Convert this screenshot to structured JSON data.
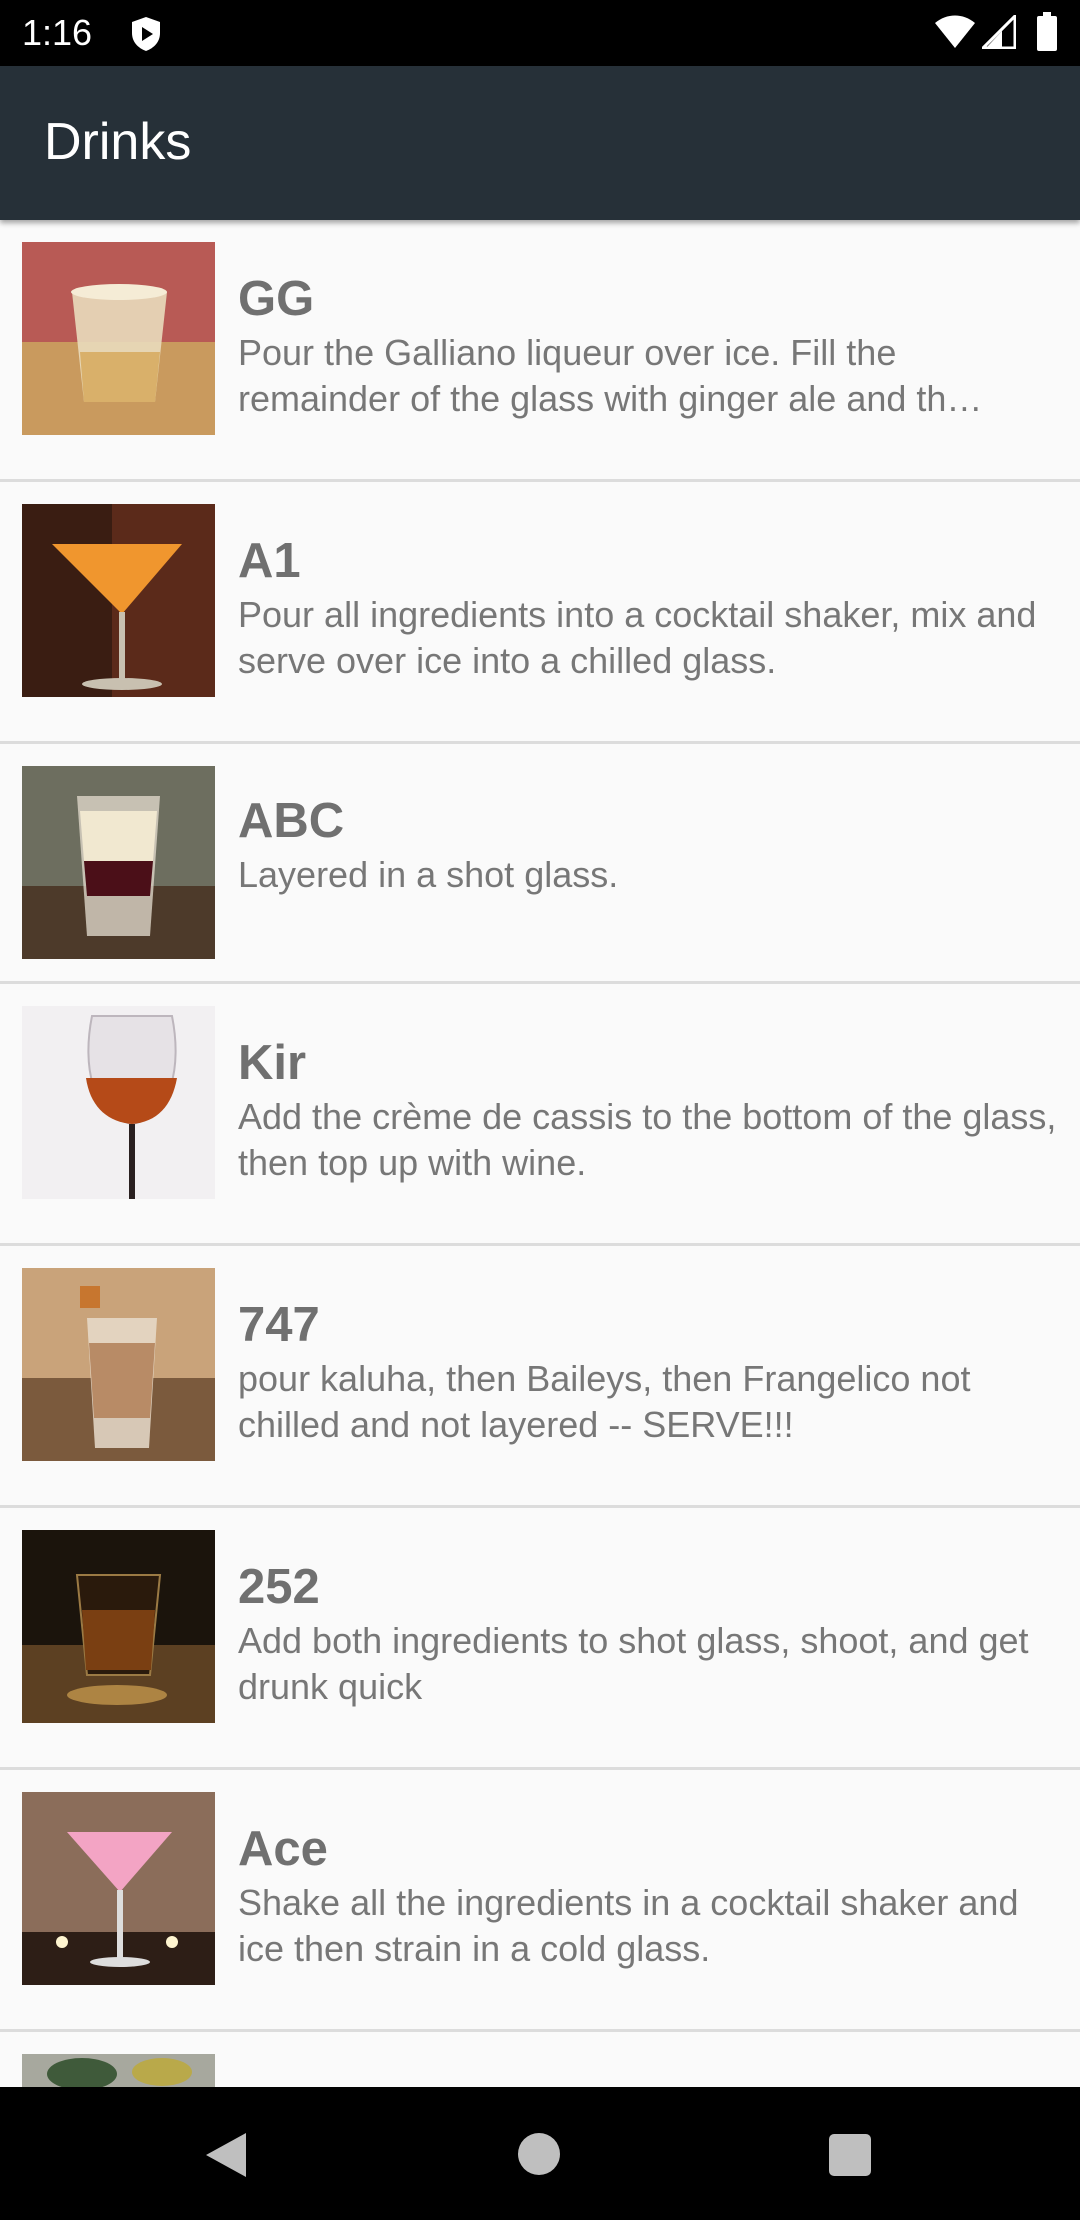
{
  "status_bar": {
    "time": "1:16",
    "icons": [
      "shield-play-icon",
      "wifi-icon",
      "cell-signal-icon",
      "battery-icon"
    ]
  },
  "app_bar": {
    "title": "Drinks"
  },
  "drinks": [
    {
      "name": "GG",
      "description": "Pour the Galliano liqueur over ice. Fill the remainder of the glass with ginger ale and th…",
      "image": "tumbler-on-ice-photo"
    },
    {
      "name": "A1",
      "description": "Pour all ingredients into a cocktail shaker, mix and serve over ice into a chilled glass.",
      "image": "orange-martini-photo"
    },
    {
      "name": "ABC",
      "description": "Layered in a shot glass.",
      "image": "layered-shot-photo"
    },
    {
      "name": "Kir",
      "description": "Add the crème de cassis to the bottom of the glass, then top up with wine.",
      "image": "wine-glass-photo"
    },
    {
      "name": "747",
      "description": "pour kaluha, then Baileys, then Frangelico not chilled and not layered -- SERVE!!!",
      "image": "creamy-shot-photo"
    },
    {
      "name": "252",
      "description": "Add both ingredients to shot glass, shoot, and get drunk quick",
      "image": "whiskey-shot-photo"
    },
    {
      "name": "Ace",
      "description": "Shake all the ingredients in a cocktail shaker and ice then strain in a cold glass.",
      "image": "pink-martini-photo"
    },
    {
      "name": "",
      "description": "",
      "image": "green-garnish-photo"
    }
  ],
  "nav_bar": {
    "buttons": [
      "back-icon",
      "home-icon",
      "recents-icon"
    ]
  }
}
